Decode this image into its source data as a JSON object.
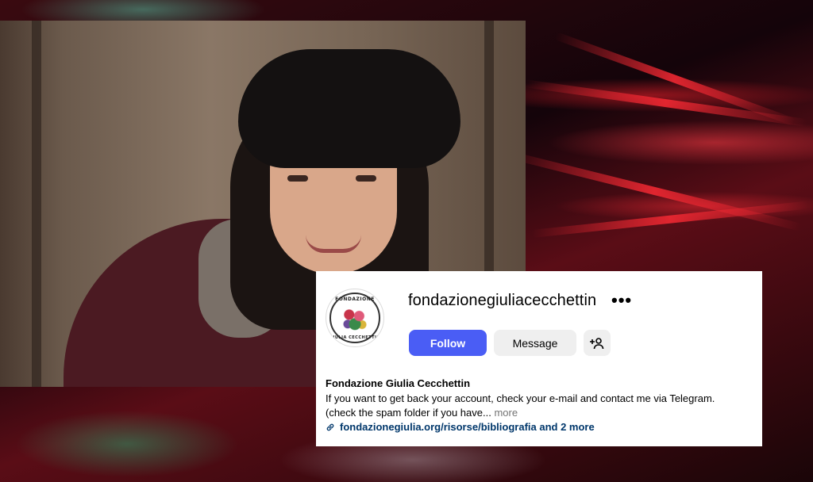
{
  "profile": {
    "username": "fondazionegiuliacecchettin",
    "avatar_text_top": "FONDAZIONE",
    "avatar_text_bottom": "GIULIA CECCHETTIN",
    "full_name": "Fondazione Giulia Cecchettin",
    "bio_line1": "If you want to get back your account, check your e-mail and contact me via Telegram.",
    "bio_line2": "(check the spam folder if you have...",
    "bio_more": "more",
    "link_text": "fondazionegiulia.org/risorse/bibliografia and 2 more"
  },
  "buttons": {
    "follow": "Follow",
    "message": "Message"
  },
  "icons": {
    "more": "more-options-icon",
    "add_user": "add-user-icon",
    "link": "link-icon"
  },
  "colors": {
    "follow_bg": "#4a5df5",
    "link": "#00376b",
    "muted": "#737373"
  }
}
